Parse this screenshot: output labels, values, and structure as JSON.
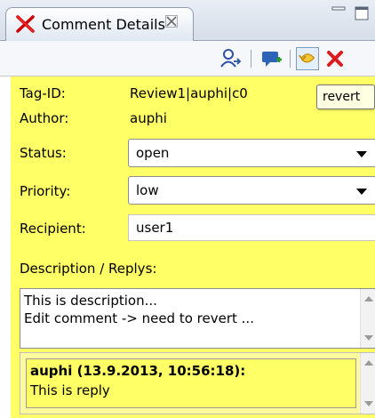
{
  "tab": {
    "title": "Comment Details",
    "close": "⌨"
  },
  "toolbar": {
    "icons": [
      "assign-user-icon",
      "add-reply-icon",
      "revert-icon",
      "delete-icon"
    ]
  },
  "tooltip": "revert",
  "fields": {
    "tag_id": {
      "label": "Tag-ID:",
      "value": "Review1|auphi|c0"
    },
    "author": {
      "label": "Author:",
      "value": "auphi"
    },
    "status": {
      "label": "Status:",
      "value": "open"
    },
    "priority": {
      "label": "Priority:",
      "value": "low"
    },
    "recipient": {
      "label": "Recipient:",
      "value": "user1"
    }
  },
  "description": {
    "label": "Description / Replys:",
    "text": "This is description...\nEdit comment -> need to revert ..."
  },
  "replies": [
    {
      "header": "auphi (13.9.2013, 10:56:18):",
      "body": "This is reply"
    }
  ],
  "colors": {
    "panel_bg": "#ffff66",
    "reply_bg": "#fffb9c"
  }
}
